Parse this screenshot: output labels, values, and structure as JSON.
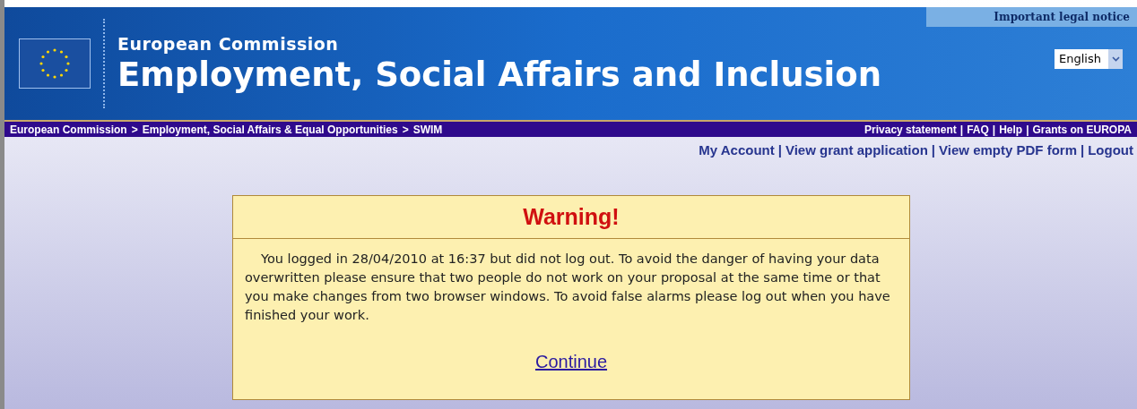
{
  "header": {
    "legal_notice": "Important legal notice",
    "org": "European Commission",
    "title": "Employment, Social Affairs and Inclusion",
    "language": "English"
  },
  "breadcrumb": [
    "European Commission",
    ">",
    "Employment, Social Affairs & Equal Opportunities",
    ">",
    "SWIM"
  ],
  "top_links": {
    "separator": "|",
    "items": [
      "Privacy statement",
      "FAQ",
      "Help",
      "Grants on EUROPA"
    ]
  },
  "account_links": {
    "separator": "|",
    "items": [
      "My Account",
      "View grant application",
      "View empty PDF form",
      "Logout"
    ]
  },
  "warning": {
    "title": "Warning!",
    "message": "You logged in 28/04/2010 at 16:37 but did not log out. To avoid the danger of having your data overwritten please ensure that two people do not work on your proposal at the same time or that you make changes from two browser windows. To avoid false alarms please log out when you have finished your work.",
    "link": "Continue"
  }
}
